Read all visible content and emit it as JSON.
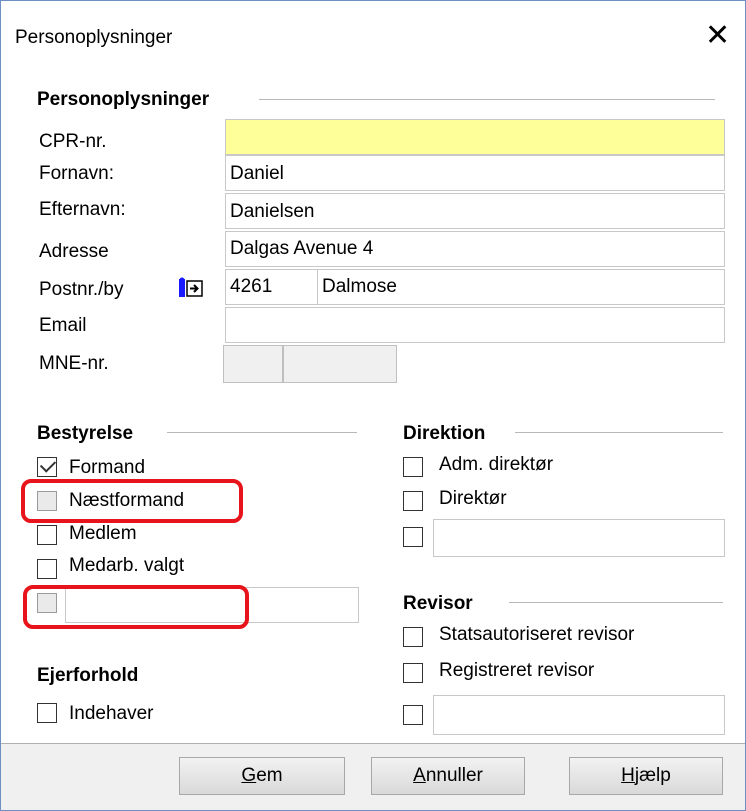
{
  "window": {
    "title": "Personoplysninger",
    "close_glyph": "✕"
  },
  "person": {
    "section_title": "Personoplysninger",
    "cpr_label": "CPR-nr.",
    "cpr_value": "",
    "fornavn_label": "Fornavn:",
    "fornavn_value": "Daniel",
    "efternavn_label": "Efternavn:",
    "efternavn_value": "Danielsen",
    "adresse_label": "Adresse",
    "adresse_value": "Dalgas Avenue 4",
    "postnr_label": "Postnr./by",
    "postnr_value": "4261",
    "by_value": "Dalmose",
    "email_label": "Email",
    "email_value": "",
    "mne_label": "MNE-nr.",
    "mne_value_1": "",
    "mne_value_2": "",
    "lookup_icon": "address-lookup-icon"
  },
  "bestyrelse": {
    "section_title": "Bestyrelse",
    "items": [
      {
        "label": "Formand",
        "checked": true
      },
      {
        "label": "Næstformand",
        "checked": false
      },
      {
        "label": "Medlem",
        "checked": false
      },
      {
        "label": "Medarb. valgt",
        "checked": false
      }
    ],
    "other_value": ""
  },
  "ejerforhold": {
    "section_title": "Ejerforhold",
    "items": [
      {
        "label": "Indehaver",
        "checked": false
      }
    ]
  },
  "direktion": {
    "section_title": "Direktion",
    "items": [
      {
        "label": "Adm. direktør",
        "checked": false
      },
      {
        "label": "Direktør",
        "checked": false
      }
    ],
    "other_value": ""
  },
  "revisor": {
    "section_title": "Revisor",
    "items": [
      {
        "label": "Statsautoriseret revisor",
        "checked": false
      },
      {
        "label": "Registreret revisor",
        "checked": false
      }
    ],
    "other_value": ""
  },
  "buttons": {
    "save_mnemonic": "G",
    "save_rest": "em",
    "cancel_mnemonic": "A",
    "cancel_rest": "nnuller",
    "help_mnemonic": "H",
    "help_rest": "jælp"
  },
  "colors": {
    "required_field": "#ffff99",
    "highlight": "#e8141b",
    "window_border": "#6d8fc4"
  }
}
